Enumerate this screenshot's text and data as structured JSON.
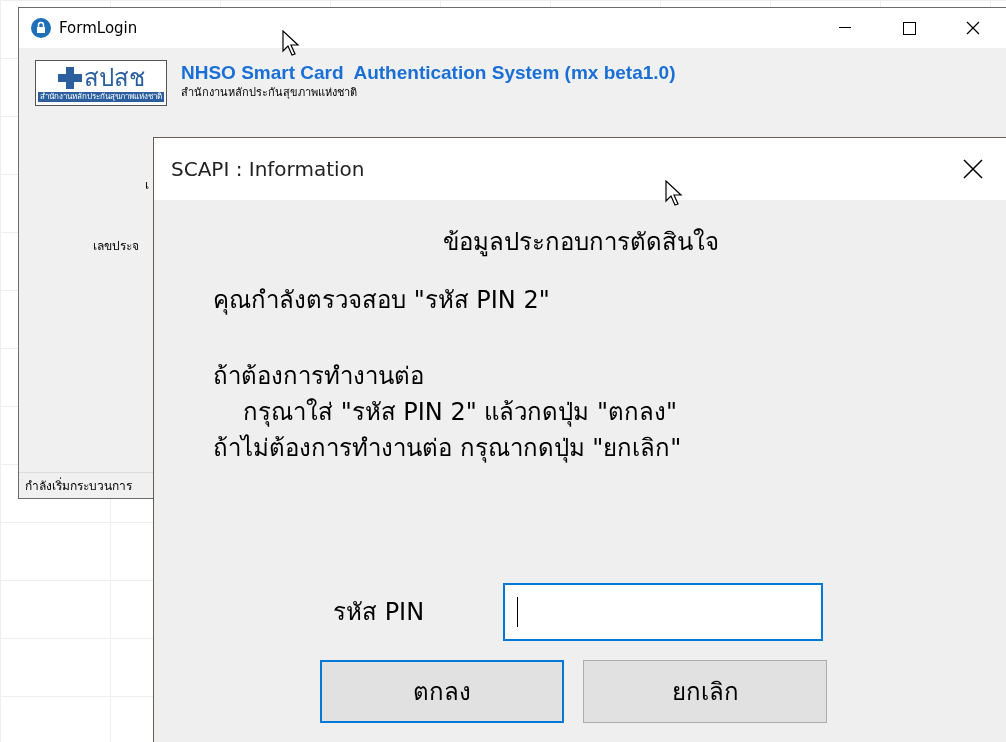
{
  "main_window": {
    "title": "FormLogin",
    "logo_text": "สปสช",
    "logo_caption": "สำนักงานหลักประกันสุขภาพแห่งชาติ",
    "app_title": "NHSO Smart Card  Authentication System (mx beta1.0)",
    "subtitle": "สำนักงานหลักประกันสุขภาพแห่งชาติ",
    "hidden_labels": [
      "เ",
      "เลขประจ"
    ],
    "status_bar": "กำลังเริ่มกระบวนการ"
  },
  "dialog": {
    "title": "SCAPI : Information",
    "heading": "ข้อมูลประกอบการตัดสินใจ",
    "paragraphs": [
      [
        {
          "text": "คุณกำลังตรวจสอบ \"รหัส PIN 2\"",
          "indent": false
        }
      ],
      [
        {
          "text": "ถ้าต้องการทำงานต่อ",
          "indent": false
        },
        {
          "text": "กรุณาใส่ \"รหัส PIN 2\" แล้วกดปุ่ม \"ตกลง\"",
          "indent": true
        },
        {
          "text": "ถ้าไม่ต้องการทำงานต่อ กรุณากดปุ่ม \"ยกเลิก\"",
          "indent": false
        }
      ]
    ],
    "pin_label": "รหัส PIN",
    "buttons": [
      {
        "label": "ตกลง",
        "selected": true
      },
      {
        "label": "ยกเลิก",
        "selected": false
      }
    ]
  }
}
